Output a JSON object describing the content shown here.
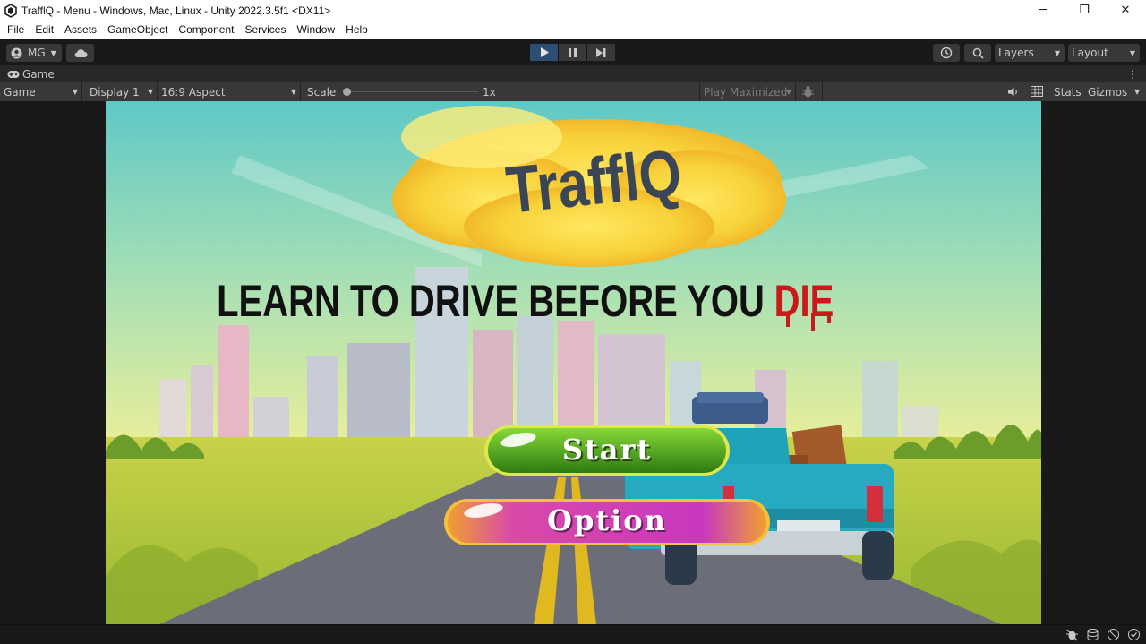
{
  "window": {
    "title": "TrafflQ - Menu - Windows, Mac, Linux - Unity 2022.3.5f1 <DX11>",
    "minimize": "─",
    "restore": "❐",
    "close": "✕"
  },
  "menu": [
    "File",
    "Edit",
    "Assets",
    "GameObject",
    "Component",
    "Services",
    "Window",
    "Help"
  ],
  "toolbar": {
    "account_label": "MG",
    "layers_label": "Layers",
    "layout_label": "Layout"
  },
  "game_tab": {
    "label": "Game"
  },
  "game_bar": {
    "view_select": "Game",
    "display_select": "Display 1",
    "aspect_select": "16:9 Aspect",
    "scale_label": "Scale",
    "scale_value": "1x",
    "play_mode_select": "Play Maximized",
    "stats_label": "Stats",
    "gizmos_label": "Gizmos"
  },
  "game": {
    "logo_text": "TrafflQ",
    "tagline": "LEARN TO DRIVE BEFORE YOU",
    "tagline_red": "DIE",
    "start_button": "Start",
    "option_button": "Option"
  },
  "colors": {
    "sky_top": "#5fc8c6",
    "sky_bottom": "#e8ee9a",
    "ground": "#b8c83a",
    "road": "#6b6e78",
    "start_green": "#4aa020",
    "option_pink": "#d03ea8",
    "play_active": "#2d4f73"
  }
}
